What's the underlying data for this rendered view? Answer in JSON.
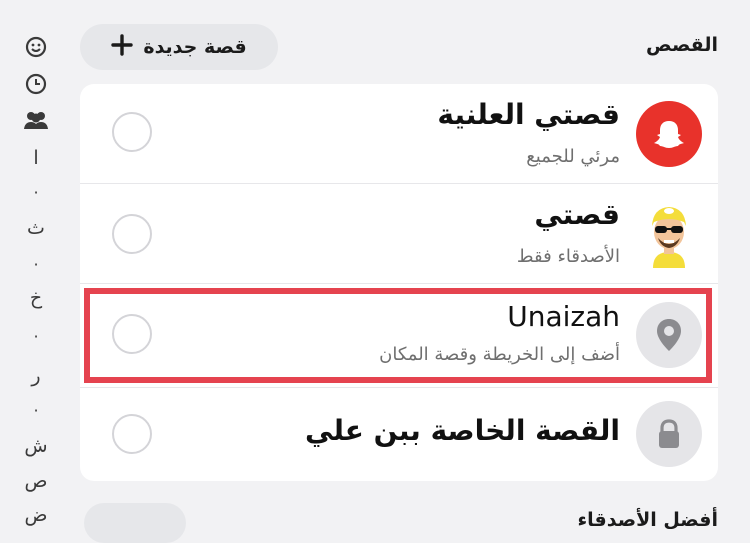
{
  "header": {
    "section_title": "القصص",
    "new_story_label": "قصة جديدة",
    "new_story_icon": "plus-icon"
  },
  "rail": {
    "icons": [
      "smiley-icon",
      "clock-icon",
      "group-icon"
    ],
    "letters": [
      "ا",
      "ث",
      "خ",
      "ر",
      "ش",
      "ص",
      "ض"
    ]
  },
  "stories": [
    {
      "title": "قصتي العلنية",
      "subtitle": "مرئي للجميع",
      "icon": "snapchat-ghost-icon",
      "accent": "#e8322b"
    },
    {
      "title": "قصتي",
      "subtitle": "الأصدقاء فقط",
      "icon": "bitmoji-avatar"
    },
    {
      "title": "Unaizah",
      "subtitle": "أضف إلى الخريطة وقصة المكان",
      "icon": "location-pin-icon"
    },
    {
      "title": "القصة الخاصة ببن علي",
      "icon": "lock-icon"
    }
  ],
  "next_section_title": "أفضل الأصدقاء",
  "colors": {
    "highlight": "#e5434f",
    "background": "#f2f2f4",
    "card": "#ffffff"
  }
}
